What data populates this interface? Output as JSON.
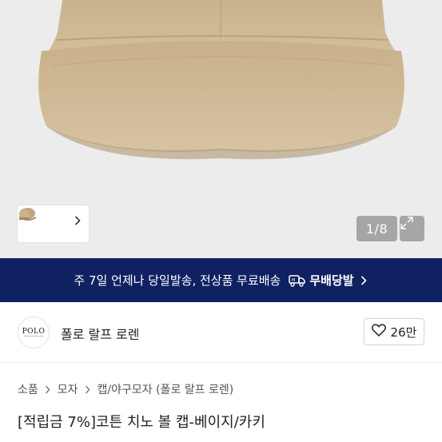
{
  "gallery": {
    "counter": "1/8",
    "thumbnails": [
      "thumbnail-1",
      "thumbnail-2",
      "thumbnail-3"
    ],
    "colors": {
      "background": "#ececec",
      "cap": "#cdb793",
      "cap_shadow": "#b79f79"
    }
  },
  "banner": {
    "message": "주 7일 언제나 당일발송, 전상품 무료배송",
    "badge": "무배당발",
    "color": "#0f2161"
  },
  "brand": {
    "logo_text": "POLO",
    "name": "폴로 랄프 로렌"
  },
  "like": {
    "count": "26만"
  },
  "breadcrumb": {
    "items": [
      "소품",
      "모자",
      "캡/야구모자 (폴로 랄프 로렌)"
    ]
  },
  "product": {
    "title": "[적립금 7%]코튼 치노 볼 캡-베이지/카키"
  }
}
